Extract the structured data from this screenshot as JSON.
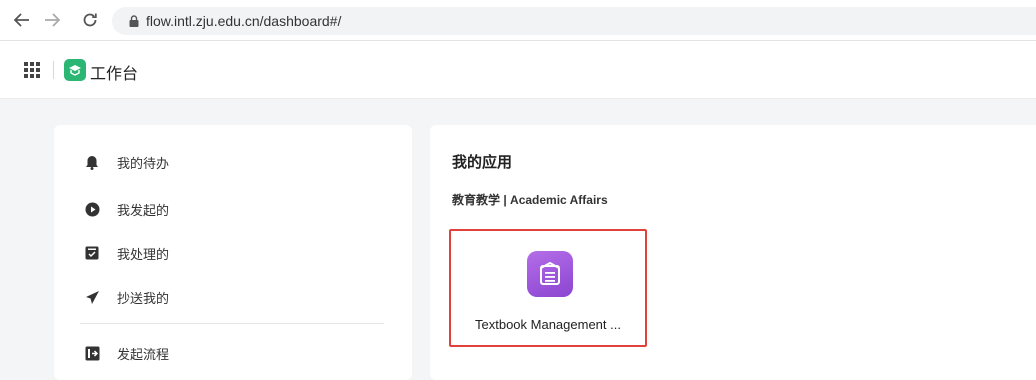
{
  "browser": {
    "url": "flow.intl.zju.edu.cn/dashboard#/"
  },
  "header": {
    "app_title": "工作台"
  },
  "sidebar": {
    "items": [
      {
        "label": "我的待办",
        "icon": "bell-icon"
      },
      {
        "label": "我发起的",
        "icon": "play-circle-icon"
      },
      {
        "label": "我处理的",
        "icon": "inbox-check-icon"
      },
      {
        "label": "抄送我的",
        "icon": "send-icon"
      },
      {
        "label": "发起流程",
        "icon": "start-process-icon"
      }
    ]
  },
  "main": {
    "section_title": "我的应用",
    "group_title": "教育教学 | Academic Affairs",
    "apps": [
      {
        "label": "Textbook Management ...",
        "icon": "document-icon",
        "icon_color": "#9b55dc"
      }
    ]
  },
  "colors": {
    "brand_green": "#2bb673",
    "highlight_red": "#e0413a"
  }
}
